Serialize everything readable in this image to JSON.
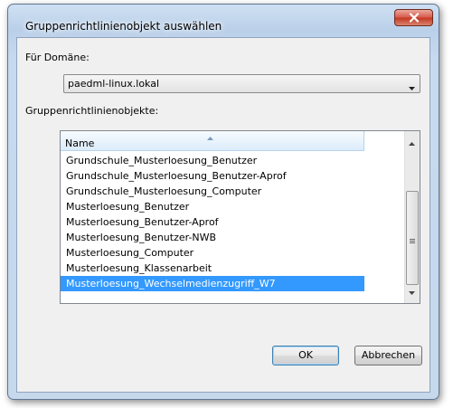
{
  "window": {
    "title": "Gruppenrichtlinienobjekt auswählen",
    "close_icon": "close-icon"
  },
  "domain": {
    "label": "Für Domäne:",
    "selected": "paedml-linux.lokal"
  },
  "gpo": {
    "label": "Gruppenrichtlinienobjekte:",
    "column_header": "Name",
    "items": [
      "Grundschule_Musterloesung_Benutzer",
      "Grundschule_Musterloesung_Benutzer-Aprof",
      "Grundschule_Musterloesung_Computer",
      "Musterloesung_Benutzer",
      "Musterloesung_Benutzer-Aprof",
      "Musterloesung_Benutzer-NWB",
      "Musterloesung_Computer",
      "Musterloesung_Klassenarbeit",
      "Musterloesung_Wechselmedienzugriff_W7"
    ],
    "selected_index": 8
  },
  "buttons": {
    "ok": "OK",
    "cancel": "Abbrechen"
  },
  "colors": {
    "selection": "#3399ff",
    "window_frame": "#bad0e9",
    "client_bg": "#f0f0f0"
  }
}
